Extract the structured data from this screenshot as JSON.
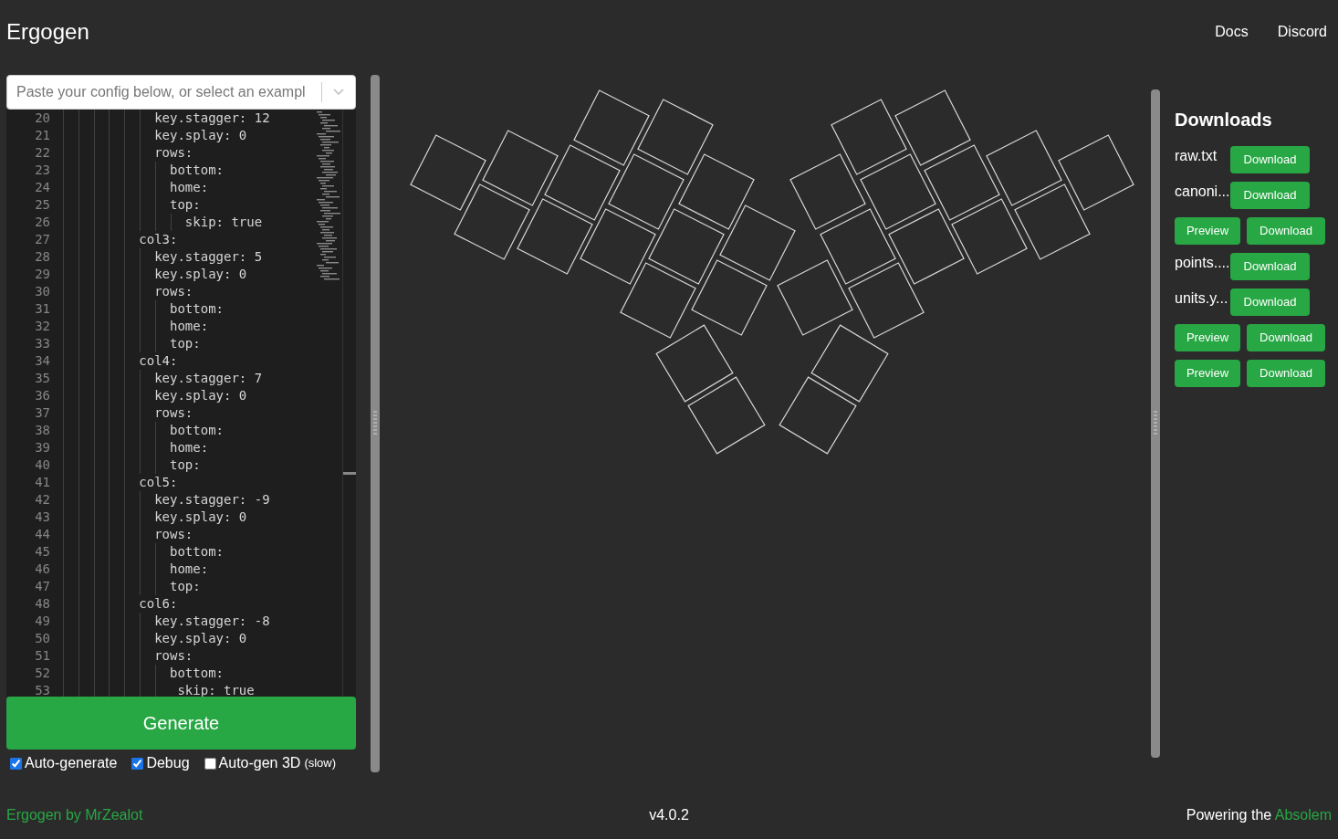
{
  "header": {
    "title": "Ergogen",
    "links": [
      "Docs",
      "Discord"
    ]
  },
  "config_select": {
    "placeholder": "Paste your config below, or select an exampl"
  },
  "editor": {
    "lines": [
      {
        "number": "20",
        "text": "            key.stagger: 12"
      },
      {
        "number": "21",
        "text": "            key.splay: 0"
      },
      {
        "number": "22",
        "text": "            rows:"
      },
      {
        "number": "23",
        "text": "              bottom:"
      },
      {
        "number": "24",
        "text": "              home:"
      },
      {
        "number": "25",
        "text": "              top:"
      },
      {
        "number": "26",
        "text": "                skip: true"
      },
      {
        "number": "27",
        "text": "          col3:"
      },
      {
        "number": "28",
        "text": "            key.stagger: 5"
      },
      {
        "number": "29",
        "text": "            key.splay: 0"
      },
      {
        "number": "30",
        "text": "            rows:"
      },
      {
        "number": "31",
        "text": "              bottom:"
      },
      {
        "number": "32",
        "text": "              home:"
      },
      {
        "number": "33",
        "text": "              top:"
      },
      {
        "number": "34",
        "text": "          col4:"
      },
      {
        "number": "35",
        "text": "            key.stagger: 7"
      },
      {
        "number": "36",
        "text": "            key.splay: 0"
      },
      {
        "number": "37",
        "text": "            rows:"
      },
      {
        "number": "38",
        "text": "              bottom:"
      },
      {
        "number": "39",
        "text": "              home:"
      },
      {
        "number": "40",
        "text": "              top:"
      },
      {
        "number": "41",
        "text": "          col5:"
      },
      {
        "number": "42",
        "text": "            key.stagger: -9"
      },
      {
        "number": "43",
        "text": "            key.splay: 0"
      },
      {
        "number": "44",
        "text": "            rows:"
      },
      {
        "number": "45",
        "text": "              bottom:"
      },
      {
        "number": "46",
        "text": "              home:"
      },
      {
        "number": "47",
        "text": "              top:"
      },
      {
        "number": "48",
        "text": "          col6:"
      },
      {
        "number": "49",
        "text": "            key.stagger: -8"
      },
      {
        "number": "50",
        "text": "            key.splay: 0"
      },
      {
        "number": "51",
        "text": "            rows:"
      },
      {
        "number": "52",
        "text": "              bottom:"
      },
      {
        "number": "53",
        "text": "               skip: true"
      }
    ]
  },
  "generate_button": "Generate",
  "options": [
    {
      "label": "Auto-generate",
      "checked": true
    },
    {
      "label": "Debug",
      "checked": true
    },
    {
      "label": "Auto-gen 3D",
      "note": "(slow)",
      "checked": false
    }
  ],
  "downloads": {
    "title": "Downloads",
    "items": [
      {
        "kind": "file",
        "name": "raw.txt",
        "button": "Download"
      },
      {
        "kind": "file",
        "name": "canoni...",
        "button": "Download"
      },
      {
        "kind": "preview",
        "preview": "Preview",
        "button": "Download"
      },
      {
        "kind": "file",
        "name": "points....",
        "button": "Download"
      },
      {
        "kind": "file",
        "name": "units.y...",
        "button": "Download"
      },
      {
        "kind": "preview",
        "preview": "Preview",
        "button": "Download"
      },
      {
        "kind": "preview",
        "preview": "Preview",
        "button": "Download"
      }
    ]
  },
  "footer": {
    "credit": "Ergogen by MrZealot",
    "version": "v4.0.2",
    "powering": {
      "text": "Powering the",
      "link": "Absolem"
    }
  }
}
